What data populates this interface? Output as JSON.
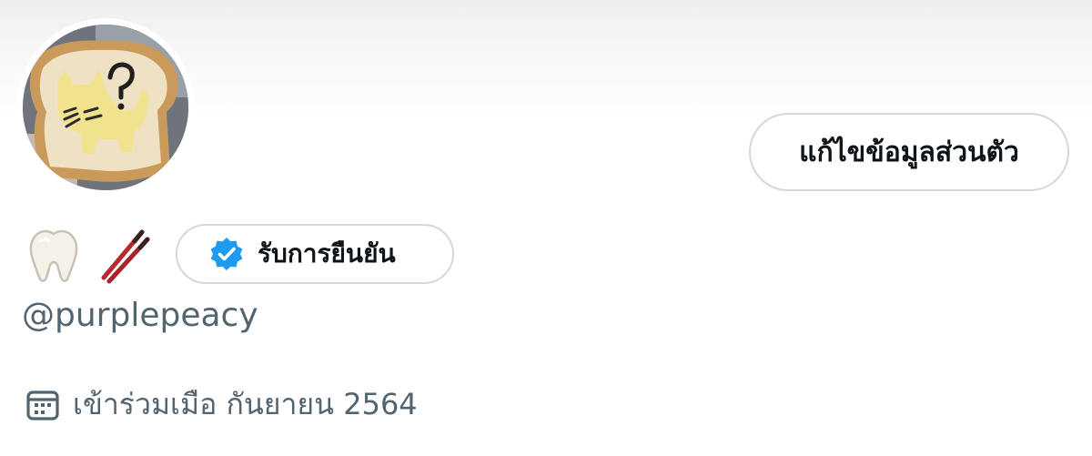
{
  "profile": {
    "avatar_icon": "toast-cat-avatar",
    "edit_button_label": "แก้ไขข้อมูลส่วนตัว",
    "name_emojis": [
      "tooth-icon",
      "chopsticks-icon"
    ],
    "verified_label": "รับการยืนยัน",
    "handle": "@purplepeacy",
    "joined_text": "เข้าร่วมเมือ กันยายน 2564"
  },
  "colors": {
    "text_primary": "#0f1419",
    "text_secondary": "#536471",
    "border": "#cfd9de",
    "verified_blue": "#1d9bf0"
  }
}
